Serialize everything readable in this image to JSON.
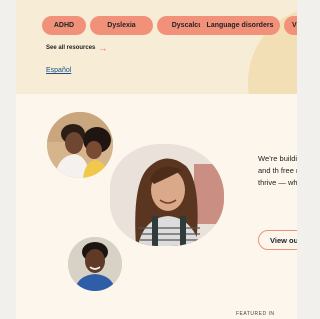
{
  "chips": [
    "ADHD",
    "Dyslexia",
    "Dyscalculia",
    "Language disorders",
    "V"
  ],
  "see_all": "See all resources",
  "language_link": "Español",
  "hero": {
    "text": "We’re buildi learn and th free resourc thrive — whi alone.",
    "cta": "View our"
  },
  "featured_label": "FEATURED IN"
}
